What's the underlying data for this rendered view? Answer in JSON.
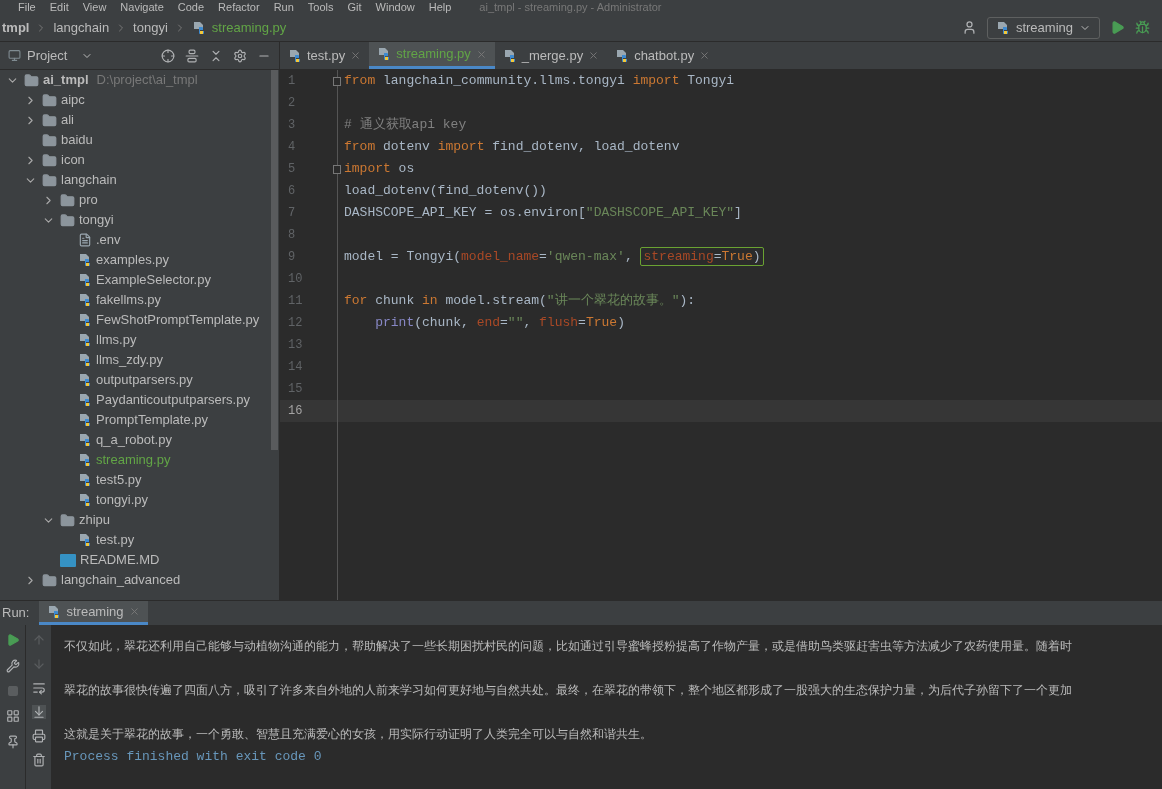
{
  "menu": [
    "File",
    "Edit",
    "View",
    "Navigate",
    "Code",
    "Refactor",
    "Run",
    "Tools",
    "Git",
    "Window",
    "Help"
  ],
  "window": {
    "title": "ai_tmpl - streaming.py - Administrator"
  },
  "breadcrumbs": [
    "tmpl",
    "langchain",
    "tongyi",
    "streaming.py"
  ],
  "run_config": {
    "label": "streaming"
  },
  "project_panel": {
    "title": "Project"
  },
  "tabs": [
    {
      "label": "test.py",
      "selected": false
    },
    {
      "label": "streaming.py",
      "selected": true
    },
    {
      "label": "_merge.py",
      "selected": false
    },
    {
      "label": "chatbot.py",
      "selected": false
    }
  ],
  "tree": [
    {
      "kind": "folder",
      "name": "ai_tmpl",
      "path": "D:\\project\\ai_tmpl",
      "expanded": true,
      "children": [
        {
          "kind": "folder",
          "name": "aipc",
          "expanded": false
        },
        {
          "kind": "folder",
          "name": "ali",
          "expanded": false
        },
        {
          "kind": "folder",
          "name": "baidu"
        },
        {
          "kind": "folder",
          "name": "icon",
          "expanded": false
        },
        {
          "kind": "folder",
          "name": "langchain",
          "expanded": true,
          "children": [
            {
              "kind": "folder",
              "name": "pro",
              "expanded": false
            },
            {
              "kind": "folder",
              "name": "tongyi",
              "expanded": true,
              "children": [
                {
                  "kind": "text",
                  "name": ".env"
                },
                {
                  "kind": "python",
                  "name": "examples.py"
                },
                {
                  "kind": "python",
                  "name": "ExampleSelector.py"
                },
                {
                  "kind": "python",
                  "name": "fakellms.py"
                },
                {
                  "kind": "python",
                  "name": "FewShotPromptTemplate.py"
                },
                {
                  "kind": "python",
                  "name": "llms.py"
                },
                {
                  "kind": "python",
                  "name": "llms_zdy.py"
                },
                {
                  "kind": "python",
                  "name": "outputparsers.py"
                },
                {
                  "kind": "python",
                  "name": "Paydanticoutputparsers.py"
                },
                {
                  "kind": "python",
                  "name": "PromptTemplate.py"
                },
                {
                  "kind": "python",
                  "name": "q_a_robot.py"
                },
                {
                  "kind": "python",
                  "name": "streaming.py",
                  "selected": true
                },
                {
                  "kind": "python",
                  "name": "test5.py"
                },
                {
                  "kind": "python",
                  "name": "tongyi.py"
                }
              ]
            },
            {
              "kind": "folder",
              "name": "zhipu",
              "expanded": true,
              "children": [
                {
                  "kind": "python",
                  "name": "test.py"
                }
              ]
            },
            {
              "kind": "markdown",
              "name": "README.MD"
            }
          ]
        },
        {
          "kind": "folder",
          "name": "langchain_advanced",
          "expanded": false
        }
      ]
    }
  ],
  "code": [
    {
      "n": "1",
      "fold": true,
      "tokens": [
        {
          "t": "from ",
          "kind": "keyword"
        },
        {
          "t": "langchain_community.llms.tongyi ",
          "kind": "plain"
        },
        {
          "t": "import ",
          "kind": "keyword"
        },
        {
          "t": "Tongyi",
          "kind": "plain"
        }
      ]
    },
    {
      "n": "2"
    },
    {
      "n": "3",
      "tokens": [
        {
          "t": "# 通义获取api key",
          "kind": "comment"
        }
      ]
    },
    {
      "n": "4",
      "tokens": [
        {
          "t": "from ",
          "kind": "keyword"
        },
        {
          "t": "dotenv ",
          "kind": "plain"
        },
        {
          "t": "import ",
          "kind": "keyword"
        },
        {
          "t": "find_dotenv, load_dotenv",
          "kind": "plain"
        }
      ]
    },
    {
      "n": "5",
      "fold": true,
      "tokens": [
        {
          "t": "import ",
          "kind": "keyword"
        },
        {
          "t": "os",
          "kind": "plain"
        }
      ]
    },
    {
      "n": "6",
      "tokens": [
        {
          "t": "load_dotenv(find_dotenv())",
          "kind": "plain"
        }
      ]
    },
    {
      "n": "7",
      "tokens": [
        {
          "t": "DASHSCOPE_API_KEY = os.environ[",
          "kind": "plain"
        },
        {
          "t": "\"DASHSCOPE_API_KEY\"",
          "kind": "string"
        },
        {
          "t": "]",
          "kind": "plain"
        }
      ]
    },
    {
      "n": "8"
    },
    {
      "n": "9",
      "tokens": [
        {
          "t": "model = Tongyi(",
          "kind": "plain"
        },
        {
          "t": "model_name",
          "kind": "param"
        },
        {
          "t": "=",
          "kind": "plain"
        },
        {
          "t": "'qwen-max'",
          "kind": "string"
        },
        {
          "t": ", ",
          "kind": "plain"
        },
        {
          "t": "streaming",
          "kind": "param",
          "highlighted": true
        },
        {
          "t": "=",
          "kind": "plain",
          "highlighted": true
        },
        {
          "t": "True",
          "kind": "keyword",
          "highlighted": true
        },
        {
          "t": ")",
          "kind": "plain",
          "highlighted": true
        }
      ]
    },
    {
      "n": "10"
    },
    {
      "n": "11",
      "tokens": [
        {
          "t": "for ",
          "kind": "keyword"
        },
        {
          "t": "chunk ",
          "kind": "plain"
        },
        {
          "t": "in ",
          "kind": "keyword"
        },
        {
          "t": "model.stream(",
          "kind": "plain"
        },
        {
          "t": "\"讲一个翠花的故事。\"",
          "kind": "string"
        },
        {
          "t": "):",
          "kind": "plain"
        }
      ]
    },
    {
      "n": "12",
      "tokens": [
        {
          "t": "print",
          "kind": "builtin",
          "indent": true
        },
        {
          "t": "(chunk, ",
          "kind": "plain"
        },
        {
          "t": "end",
          "kind": "param"
        },
        {
          "t": "=",
          "kind": "plain"
        },
        {
          "t": "\"\"",
          "kind": "string"
        },
        {
          "t": ", ",
          "kind": "plain"
        },
        {
          "t": "flush",
          "kind": "param"
        },
        {
          "t": "=",
          "kind": "plain"
        },
        {
          "t": "True",
          "kind": "keyword"
        },
        {
          "t": ")",
          "kind": "plain"
        }
      ]
    },
    {
      "n": "13"
    },
    {
      "n": "14"
    },
    {
      "n": "15"
    },
    {
      "n": "16",
      "current": true
    }
  ],
  "run_panel": {
    "label": "Run:",
    "tab": "streaming",
    "output": [
      {
        "kind": "text",
        "t": "不仅如此，翠花还利用自己能够与动植物沟通的能力，帮助解决了一些长期困扰村民的问题，比如通过引导蜜蜂授粉提高了作物产量，或是借助鸟类驱赶害虫等方法减少了农药使用量。随着时"
      },
      {
        "kind": "blank"
      },
      {
        "kind": "text",
        "t": "翠花的故事很快传遍了四面八方，吸引了许多来自外地的人前来学习如何更好地与自然共处。最终，在翠花的带领下，整个地区都形成了一股强大的生态保护力量，为后代子孙留下了一个更加"
      },
      {
        "kind": "blank"
      },
      {
        "kind": "text",
        "t": "这就是关于翠花的故事，一个勇敢、智慧且充满爱心的女孩，用实际行动证明了人类完全可以与自然和谐共生。"
      },
      {
        "kind": "system",
        "t": "Process finished with exit code 0"
      }
    ]
  }
}
